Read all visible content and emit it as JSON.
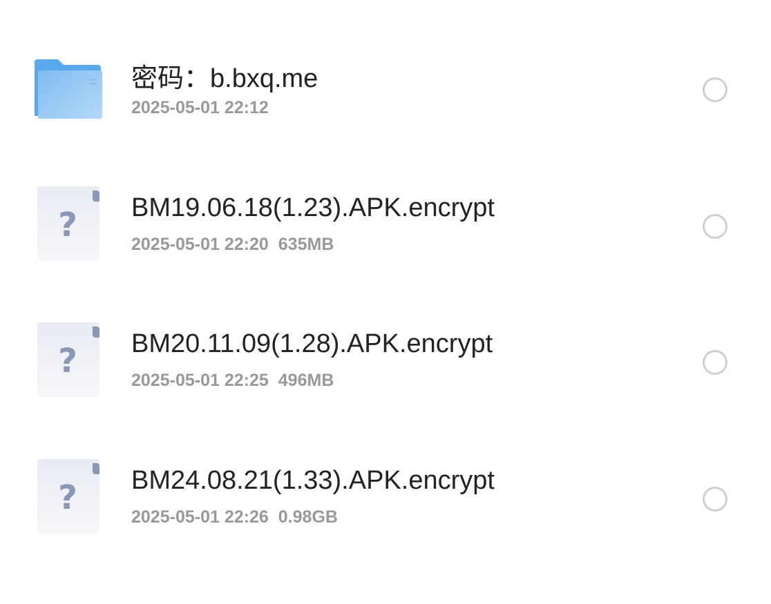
{
  "files": [
    {
      "type": "folder",
      "icon": "folder-icon",
      "name": "密码：b.bxq.me",
      "date": "2025-05-01 22:12",
      "size": ""
    },
    {
      "type": "unknown",
      "icon": "unknown-file-icon",
      "name": "BM19.06.18(1.23).APK.encrypt",
      "date": "2025-05-01 22:20",
      "size": "635MB"
    },
    {
      "type": "unknown",
      "icon": "unknown-file-icon",
      "name": "BM20.11.09(1.28).APK.encrypt",
      "date": "2025-05-01 22:25",
      "size": "496MB"
    },
    {
      "type": "unknown",
      "icon": "unknown-file-icon",
      "name": "BM24.08.21(1.33).APK.encrypt",
      "date": "2025-05-01 22:26",
      "size": "0.98GB"
    }
  ],
  "colors": {
    "folder": "#5aa9ef",
    "unknown_icon": "#8a98b8",
    "radio_border": "#cfcfcf"
  }
}
